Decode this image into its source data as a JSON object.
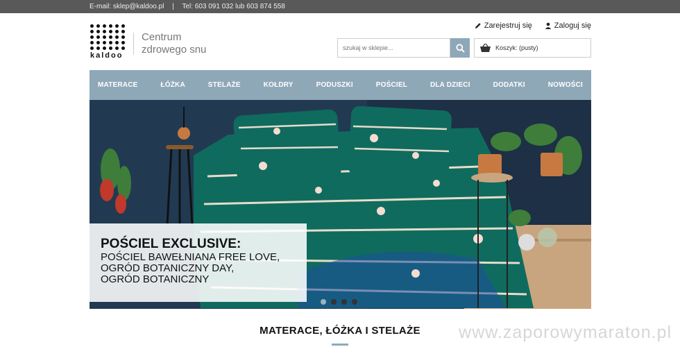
{
  "topbar": {
    "email": "E-mail: sklep@kaldoo.pl",
    "separator": "|",
    "phone": "Tel: 603 091 032 lub 603 874 558"
  },
  "logo": {
    "word": "kaldoo",
    "tagline_1": "Centrum",
    "tagline_2": "zdrowego snu"
  },
  "account": {
    "register": "Zarejestruj się",
    "login": "Zaloguj się"
  },
  "search": {
    "placeholder": "szukaj w sklepie..."
  },
  "cart": {
    "label": "Koszyk: (pusty)"
  },
  "nav": [
    "MATERACE",
    "ŁÓŻKA",
    "STELAŻE",
    "KOŁDRY",
    "PODUSZKI",
    "POŚCIEL",
    "DLA DZIECI",
    "DODATKI",
    "NOWOŚCI"
  ],
  "hero": {
    "title": "POŚCIEL EXCLUSIVE:",
    "line_1": "POŚCIEL BAWEŁNIANA FREE LOVE,",
    "line_2": "OGRÓD BOTANICZNY DAY,",
    "line_3": "OGRÓD BOTANICZNY",
    "slides": 4,
    "active_slide": 1
  },
  "section": {
    "title": "MATERACE, ŁÓŻKA I STELAŻE"
  },
  "watermark": "www.zaporowymaraton.pl",
  "colors": {
    "accent": "#8fa8b8",
    "topbar": "#595959",
    "bedding": "#0f6b5e"
  }
}
